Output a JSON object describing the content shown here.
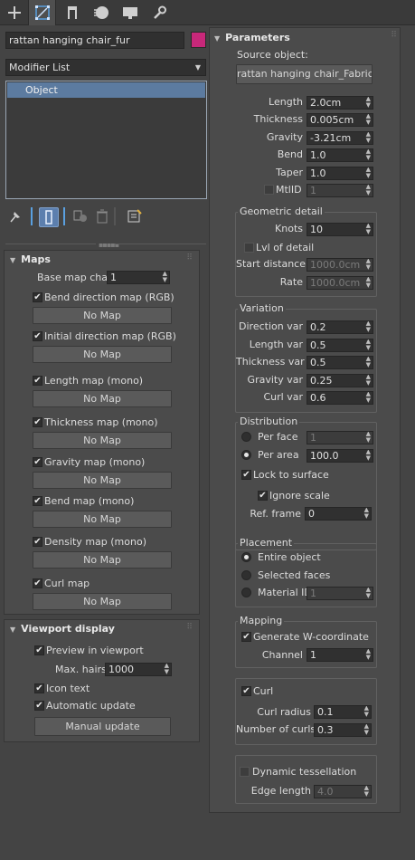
{
  "tabs": {
    "create": "create-icon",
    "modify": "modify-icon",
    "hierarchy": "hierarchy-icon",
    "motion": "motion-icon",
    "display": "display-icon",
    "utilities": "utilities-icon"
  },
  "object_name": "rattan hanging chair_fur",
  "object_color": "#c8287a",
  "modifier_list": "Modifier List",
  "stack_items": [
    "Object"
  ],
  "maps": {
    "title": "Maps",
    "base_map_chan_label": "Base map chan",
    "base_map_chan_value": "1",
    "entries": [
      {
        "label": "Bend direction map (RGB)",
        "button": "No Map"
      },
      {
        "label": "Initial direction map (RGB)",
        "button": "No Map"
      },
      {
        "label": "Length map (mono)",
        "button": "No Map"
      },
      {
        "label": "Thickness map (mono)",
        "button": "No Map"
      },
      {
        "label": "Gravity map (mono)",
        "button": "No Map"
      },
      {
        "label": "Bend map (mono)",
        "button": "No Map"
      },
      {
        "label": "Density map (mono)",
        "button": "No Map"
      },
      {
        "label": "Curl map",
        "button": "No Map"
      }
    ]
  },
  "viewport": {
    "title": "Viewport display",
    "preview": "Preview in viewport",
    "max_hairs_label": "Max. hairs",
    "max_hairs": "1000",
    "icon_text": "Icon text",
    "auto_update": "Automatic update",
    "manual_update": "Manual update"
  },
  "params": {
    "title": "Parameters",
    "source_label": "Source object:",
    "source_button": "rattan hanging chair_Fabric",
    "length_label": "Length",
    "length": "2.0cm",
    "thickness_label": "Thickness",
    "thickness": "0.005cm",
    "gravity_label": "Gravity",
    "gravity": "-3.21cm",
    "bend_label": "Bend",
    "bend": "1.0",
    "taper_label": "Taper",
    "taper": "1.0",
    "mtlid_label": "MtlID",
    "mtlid": "1"
  },
  "geom": {
    "title": "Geometric detail",
    "knots_label": "Knots",
    "knots": "10",
    "lod_label": "Lvl of detail",
    "start_label": "Start distance",
    "start": "1000.0cm",
    "rate_label": "Rate",
    "rate": "1000.0cm"
  },
  "variation": {
    "title": "Variation",
    "dir_label": "Direction var",
    "dir": "0.2",
    "len_label": "Length var",
    "len": "0.5",
    "thick_label": "Thickness var",
    "thick": "0.5",
    "grav_label": "Gravity var",
    "grav": "0.25",
    "curl_label": "Curl var",
    "curl": "0.6"
  },
  "distribution": {
    "title": "Distribution",
    "per_face_label": "Per face",
    "per_face": "1",
    "per_area_label": "Per area",
    "per_area": "100.0",
    "lock_label": "Lock to surface",
    "ignore_label": "Ignore scale",
    "ref_label": "Ref. frame",
    "ref": "0"
  },
  "placement": {
    "title": "Placement",
    "entire": "Entire object",
    "selected": "Selected faces",
    "material_label": "Material ID",
    "material": "1"
  },
  "mapping": {
    "title": "Mapping",
    "generate": "Generate W-coordinate",
    "channel_label": "Channel",
    "channel": "1"
  },
  "curl": {
    "label": "Curl",
    "radius_label": "Curl radius",
    "radius": "0.1",
    "number_label": "Number of curls",
    "number": "0.3"
  },
  "tess": {
    "label": "Dynamic tessellation",
    "edge_label": "Edge length",
    "edge": "4.0"
  }
}
